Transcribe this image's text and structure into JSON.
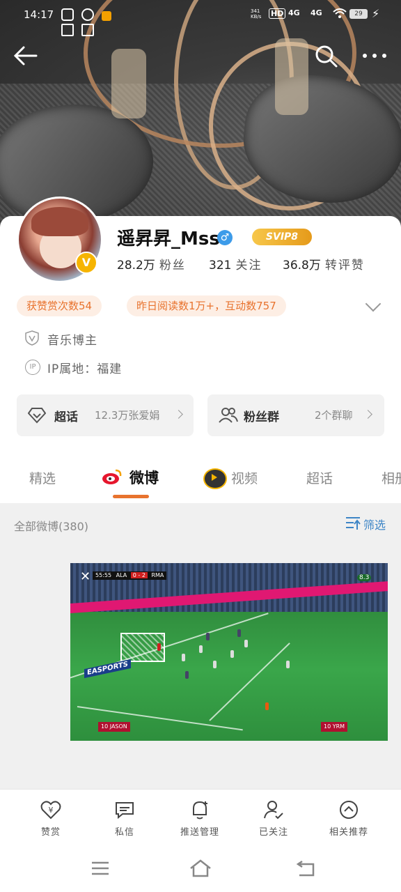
{
  "status_bar": {
    "time": "14:17",
    "network_speed": "341 KB/s",
    "signal_1": "4G",
    "signal_2": "4G",
    "hd_badge": "HD",
    "battery": "29"
  },
  "profile": {
    "name": "遥昇昇_Mss",
    "vip_badge": "SVIP8",
    "avatar_badge": "V",
    "gender_symbol": "♂",
    "stats": [
      {
        "value": "28.2万",
        "label": "粉丝"
      },
      {
        "value": "321",
        "label": "关注"
      },
      {
        "value": "36.8万",
        "label": "转评赞"
      }
    ],
    "pills": [
      "获赞赏次数54",
      "昨日阅读数1万+，互动数757"
    ],
    "tag": "音乐博主",
    "ip_icon_text": "IP",
    "ip_location": "IP属地：福建",
    "boxes": [
      {
        "title": "超话",
        "sub": "12.3万张爱娟"
      },
      {
        "title": "粉丝群",
        "sub": "2个群聊"
      }
    ]
  },
  "tabs": [
    {
      "label": "精选",
      "active": false
    },
    {
      "label": "微博",
      "active": true
    },
    {
      "label": "视频",
      "active": false
    },
    {
      "label": "超话",
      "active": false
    },
    {
      "label": "相册",
      "active": false
    }
  ],
  "feed": {
    "count_label": "全部微博(380)",
    "filter_label": "筛选",
    "video": {
      "score_time": "55:55",
      "home": "ALA",
      "score": "0 - 2",
      "away": "RMA",
      "player_left": "10 JASON",
      "player_right": "10 YRM",
      "ad_text": "EASPORTS",
      "corner_number": "8.3"
    }
  },
  "bottom_bar": [
    {
      "label": "赞赏",
      "icon": "heart-yen-icon"
    },
    {
      "label": "私信",
      "icon": "message-icon"
    },
    {
      "label": "推送管理",
      "icon": "bell-plus-icon"
    },
    {
      "label": "已关注",
      "icon": "user-check-icon"
    },
    {
      "label": "相关推荐",
      "icon": "chevron-circle-icon"
    }
  ],
  "colors": {
    "accent": "#e8732e",
    "pill_bg": "#fdeee4",
    "link": "#3d85c6",
    "vip_gold": "#f6b400"
  }
}
